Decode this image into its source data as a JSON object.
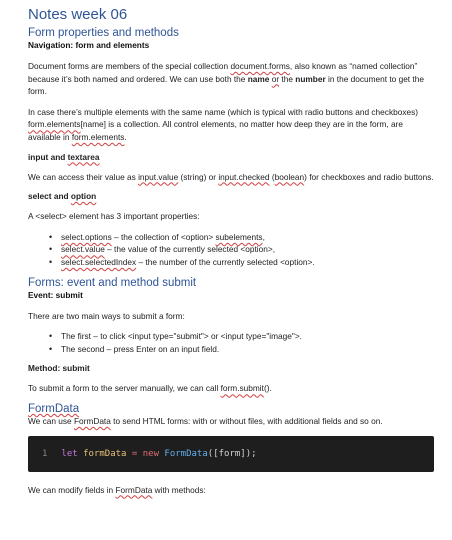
{
  "title": "Notes week 06",
  "s1": {
    "heading": "Form properties and methods",
    "sub": "Navigation: form and elements",
    "p1": {
      "a": "Document forms are members of the special collection ",
      "b": "document.forms",
      "c": ", also known as “named collection” because it’s both named and ordered. We can use both the ",
      "d": "name",
      "e": " ",
      "f": "or",
      "g": " the ",
      "h": "number",
      "i": " in the document to get the form."
    },
    "p2": {
      "a": "In case there’s multiple elements with the same name (which is typical with radio buttons and checkboxes) ",
      "b": "form.elements",
      "c": "[name] is a collection. All control elements, no matter how deep they are in the form, are available in ",
      "d": "form.elements",
      "e": "."
    },
    "h_input": {
      "a": "input and ",
      "b": "textarea"
    },
    "p3": {
      "a": "We can access their value as ",
      "b": "input.value",
      "c": " (string) or ",
      "d": "input.checked",
      "e": " (",
      "f": "boolean",
      "g": ") for checkboxes and radio buttons."
    },
    "h_select": {
      "a": "select and ",
      "b": "option"
    },
    "p4": "A <select> element has 3 important properties:",
    "bullets": [
      {
        "a": "select.options",
        "b": " – the collection of <option> ",
        "c": "subelements",
        "d": ","
      },
      {
        "a": "select.value",
        "b": " – the value of the currently selected <option>,"
      },
      {
        "a": "select.selectedIndex",
        "b": " – the number of the currently selected <option>."
      }
    ]
  },
  "s2": {
    "heading": "Forms: event and method submit",
    "sub": "Event: submit",
    "p1": "There are two main ways to submit a form:",
    "bullets": [
      "The first – to click <input type=\"submit\"> or <input type=\"image\">.",
      "The second – press Enter on an input field."
    ],
    "method": "Method: submit",
    "p2": {
      "a": "To submit a form to the server manually, we can call ",
      "b": "form.submit",
      "c": "()."
    }
  },
  "s3": {
    "heading": "FormData",
    "p1": {
      "a": "We can use ",
      "b": "FormData",
      "c": " to send HTML forms: with or without files, with additional fields and so on."
    },
    "code": {
      "line_no": "1",
      "kw": "let",
      "var": "formData",
      "eq": "=",
      "new": "new",
      "cls": "FormData",
      "args": "([form]);"
    },
    "p2": {
      "a": "We can modify fields in ",
      "b": "FormData",
      "c": " with methods:"
    }
  }
}
